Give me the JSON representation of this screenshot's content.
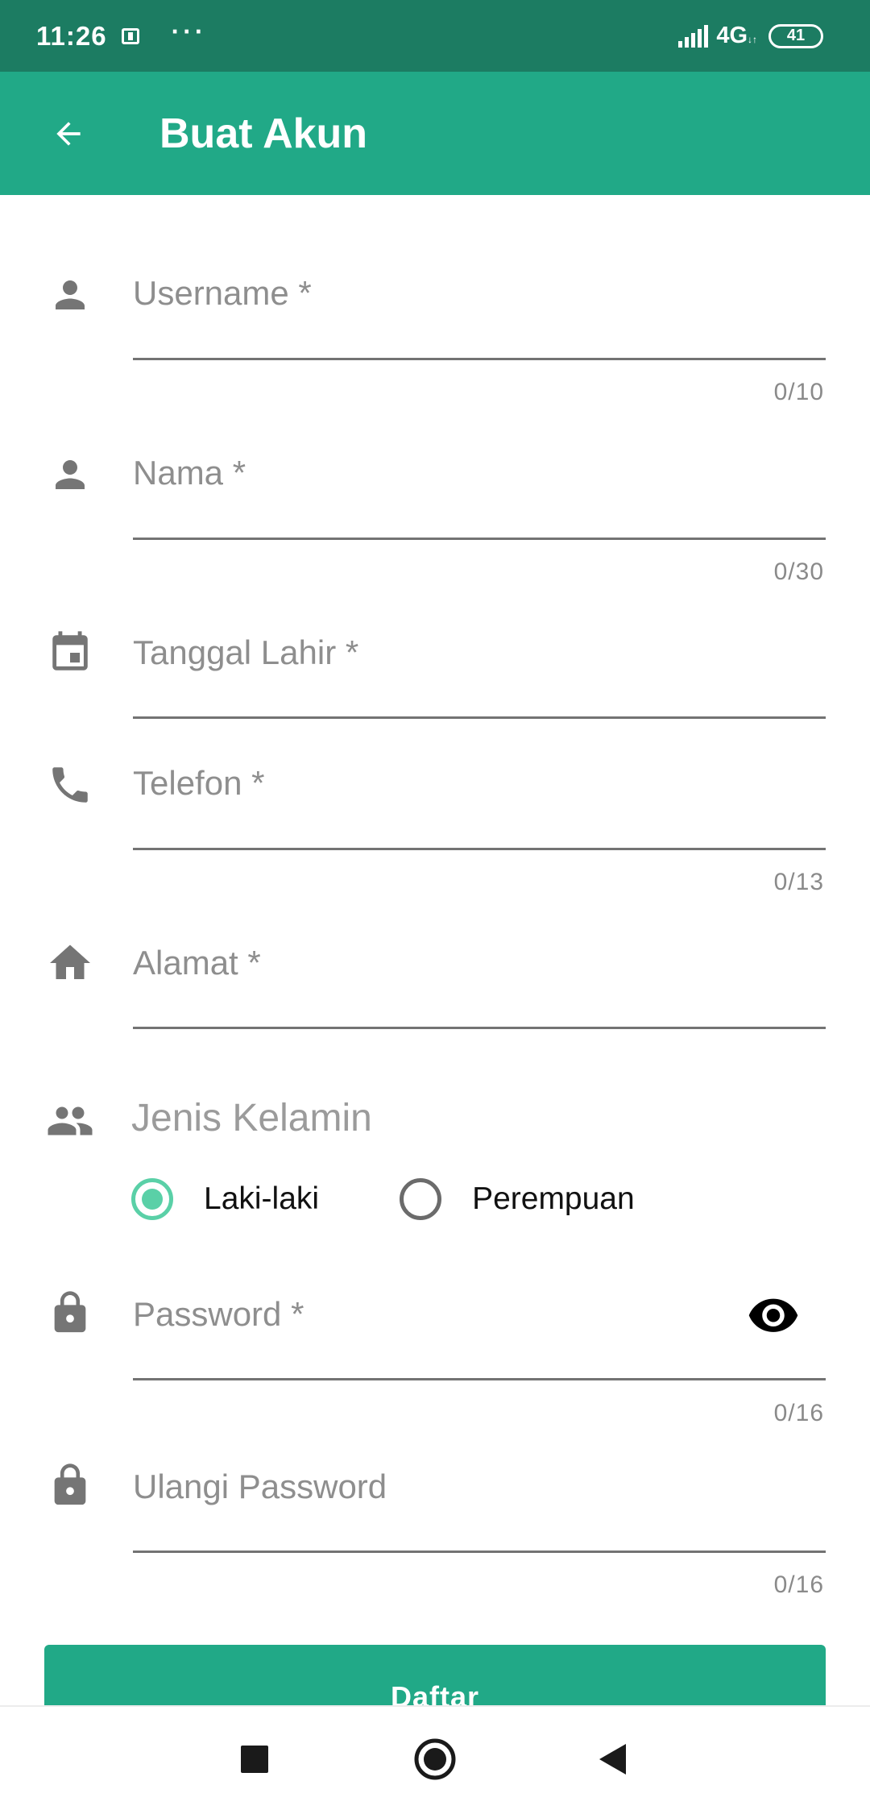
{
  "status_bar": {
    "time": "11:26",
    "dots": "···",
    "network": "4G",
    "battery": "41"
  },
  "app_bar": {
    "title": "Buat Akun"
  },
  "form": {
    "username": {
      "label": "Username *",
      "counter": "0/10",
      "icon": "person-icon"
    },
    "nama": {
      "label": "Nama *",
      "counter": "0/30",
      "icon": "person-icon"
    },
    "tanggal_lahir": {
      "label": "Tanggal Lahir *",
      "icon": "calendar-icon"
    },
    "telefon": {
      "label": "Telefon *",
      "counter": "0/13",
      "icon": "phone-icon"
    },
    "alamat": {
      "label": "Alamat *",
      "icon": "home-icon"
    },
    "jenis_kelamin": {
      "label": "Jenis Kelamin",
      "icon": "people-icon",
      "options": [
        "Laki-laki",
        "Perempuan"
      ],
      "selected": "Laki-laki"
    },
    "password": {
      "label": "Password *",
      "counter": "0/16",
      "icon": "lock-icon"
    },
    "ulangi_password": {
      "label": "Ulangi Password",
      "counter": "0/16",
      "icon": "lock-icon"
    }
  },
  "submit_label": "Daftar",
  "colors": {
    "status_bar": "#1c7c62",
    "primary": "#21a987",
    "radio_selected": "#5ad0a7",
    "icon_gray": "#757575"
  }
}
